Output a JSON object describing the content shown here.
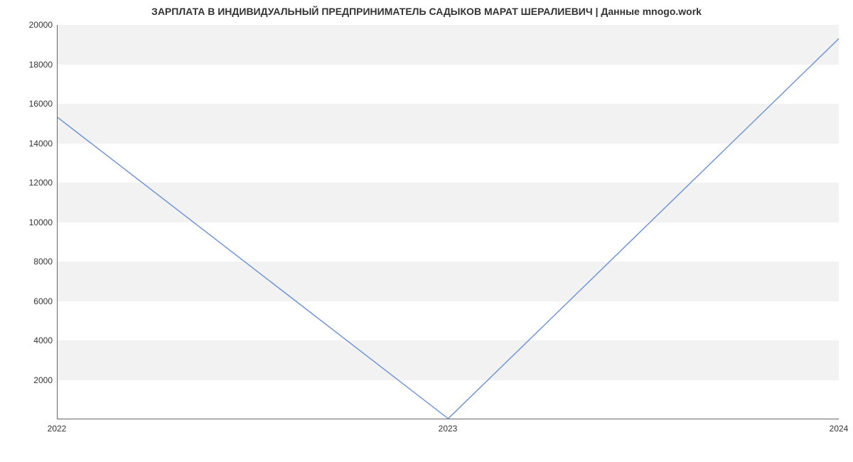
{
  "chart_data": {
    "type": "line",
    "title": "ЗАРПЛАТА В ИНДИВИДУАЛЬНЫЙ ПРЕДПРИНИМАТЕЛЬ САДЫКОВ МАРАТ ШЕРАЛИЕВИЧ | Данные mnogo.work",
    "xlabel": "",
    "ylabel": "",
    "x": [
      "2022",
      "2023",
      "2024"
    ],
    "values": [
      15300,
      0,
      19300
    ],
    "xlim": [
      2022,
      2024
    ],
    "ylim": [
      0,
      20000
    ],
    "yticks": [
      2000,
      4000,
      6000,
      8000,
      10000,
      12000,
      14000,
      16000,
      18000,
      20000
    ],
    "xticks": [
      "2022",
      "2023",
      "2024"
    ],
    "line_color": "#6a8fd8",
    "band_color": "#f2f2f2",
    "grid": false
  }
}
